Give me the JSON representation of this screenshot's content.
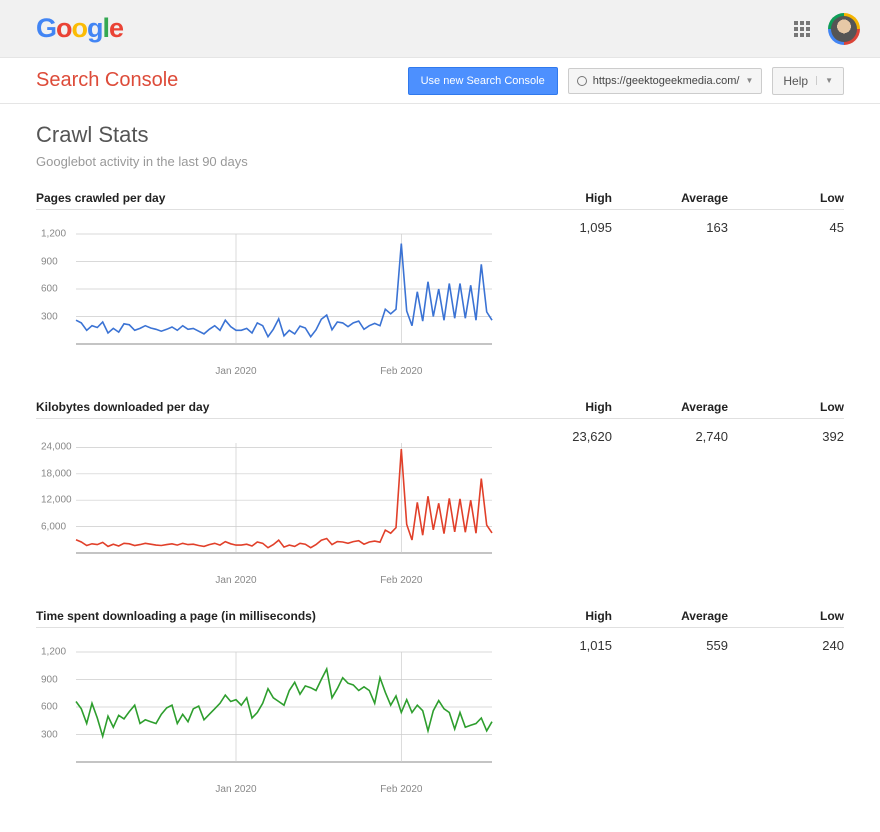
{
  "header": {
    "logo_text": "Google",
    "apps_icon": "apps-grid-icon",
    "avatar": "user-avatar"
  },
  "subheader": {
    "product_name": "Search Console",
    "new_console_btn": "Use new Search Console",
    "property_url": "https://geektogeekmedia.com/",
    "help_label": "Help"
  },
  "page": {
    "title": "Crawl Stats",
    "subtitle": "Googlebot activity in the last 90 days"
  },
  "stats_headers": {
    "high": "High",
    "average": "Average",
    "low": "Low"
  },
  "metrics": [
    {
      "title": "Pages crawled per day",
      "high": "1,095",
      "average": "163",
      "low": "45"
    },
    {
      "title": "Kilobytes downloaded per day",
      "high": "23,620",
      "average": "2,740",
      "low": "392"
    },
    {
      "title": "Time spent downloading a page (in milliseconds)",
      "high": "1,015",
      "average": "559",
      "low": "240"
    }
  ],
  "chart_data": [
    {
      "type": "line",
      "title": "Pages crawled per day",
      "color": "#3b73d4",
      "ylim": [
        0,
        1200
      ],
      "y_ticks": [
        300,
        600,
        900,
        1200
      ],
      "x_month_ticks": [
        {
          "label": "Jan 2020",
          "index": 30
        },
        {
          "label": "Feb 2020",
          "index": 61
        }
      ],
      "values": [
        260,
        230,
        150,
        200,
        180,
        240,
        120,
        170,
        130,
        220,
        210,
        150,
        170,
        200,
        175,
        160,
        140,
        160,
        185,
        150,
        200,
        160,
        170,
        140,
        110,
        160,
        200,
        150,
        260,
        190,
        150,
        150,
        170,
        120,
        230,
        200,
        80,
        160,
        275,
        90,
        150,
        110,
        195,
        175,
        80,
        155,
        270,
        315,
        155,
        240,
        230,
        190,
        230,
        250,
        160,
        200,
        225,
        200,
        380,
        330,
        380,
        1095,
        360,
        200,
        570,
        250,
        680,
        300,
        600,
        260,
        660,
        280,
        660,
        280,
        640,
        260,
        870,
        350,
        260
      ]
    },
    {
      "type": "line",
      "title": "Kilobytes downloaded per day",
      "color": "#e1402a",
      "ylim": [
        0,
        25000
      ],
      "y_ticks": [
        6000,
        12000,
        18000,
        24000
      ],
      "x_month_ticks": [
        {
          "label": "Jan 2020",
          "index": 30
        },
        {
          "label": "Feb 2020",
          "index": 61
        }
      ],
      "values": [
        3000,
        2500,
        1700,
        2100,
        1900,
        2400,
        1500,
        2000,
        1600,
        2200,
        2100,
        1700,
        1900,
        2200,
        2000,
        1800,
        1700,
        1900,
        2100,
        1800,
        2200,
        1900,
        2000,
        1700,
        1500,
        1900,
        2200,
        1800,
        2600,
        2100,
        1800,
        1800,
        2000,
        1600,
        2500,
        2200,
        1200,
        1900,
        2900,
        1350,
        1800,
        1500,
        2200,
        2000,
        1200,
        1900,
        2900,
        3300,
        1900,
        2600,
        2500,
        2200,
        2600,
        2800,
        2000,
        2500,
        2700,
        2450,
        5200,
        4500,
        5750,
        23620,
        6500,
        2950,
        11500,
        4050,
        12900,
        5250,
        11300,
        4400,
        12400,
        4800,
        12300,
        4700,
        12000,
        4500,
        16900,
        6350,
        4575
      ]
    },
    {
      "type": "line",
      "title": "Time spent downloading a page (in milliseconds)",
      "color": "#2e9e2e",
      "ylim": [
        0,
        1200
      ],
      "y_ticks": [
        300,
        600,
        900,
        1200
      ],
      "x_month_ticks": [
        {
          "label": "Jan 2020",
          "index": 30
        },
        {
          "label": "Feb 2020",
          "index": 61
        }
      ],
      "values": [
        660,
        580,
        420,
        640,
        480,
        280,
        500,
        380,
        510,
        470,
        550,
        620,
        420,
        460,
        440,
        420,
        520,
        590,
        620,
        420,
        520,
        440,
        580,
        610,
        460,
        520,
        580,
        640,
        730,
        660,
        680,
        620,
        700,
        480,
        540,
        640,
        800,
        700,
        660,
        620,
        780,
        870,
        740,
        830,
        810,
        780,
        900,
        1015,
        700,
        800,
        920,
        860,
        840,
        780,
        820,
        780,
        640,
        920,
        760,
        620,
        720,
        540,
        680,
        540,
        620,
        560,
        340,
        560,
        670,
        580,
        540,
        360,
        540,
        380,
        400,
        420,
        480,
        340,
        440
      ]
    }
  ]
}
